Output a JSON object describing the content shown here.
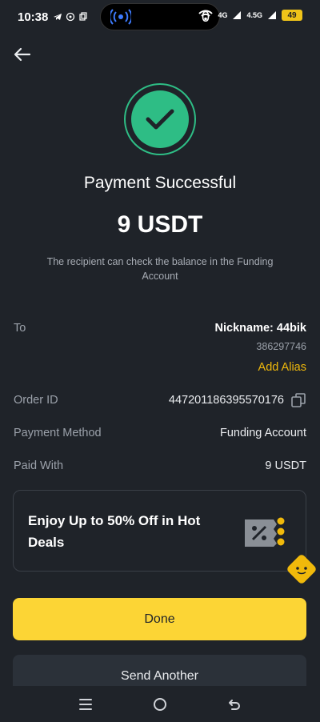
{
  "status_bar": {
    "time": "10:38",
    "island_count": "0",
    "network_left": "4G",
    "network_right": "4.5G",
    "battery": "49"
  },
  "header": {
    "back_icon": "arrow-left-icon"
  },
  "result": {
    "title": "Payment Successful",
    "amount": "9 USDT",
    "note": "The recipient can check the balance in the Funding Account"
  },
  "details": {
    "to_label": "To",
    "nickname": "Nickname: 44bik",
    "uid": "386297746",
    "add_alias": "Add Alias",
    "order_label": "Order ID",
    "order_id": "447201186395570176",
    "method_label": "Payment Method",
    "method_value": "Funding Account",
    "paid_label": "Paid With",
    "paid_value": "9 USDT"
  },
  "promo": {
    "text": "Enjoy Up to 50% Off in Hot Deals"
  },
  "actions": {
    "done": "Done",
    "send_another": "Send Another"
  },
  "colors": {
    "accent": "#fcd535",
    "success": "#2ebd85",
    "link": "#f0b90b",
    "background": "#1f2329"
  }
}
